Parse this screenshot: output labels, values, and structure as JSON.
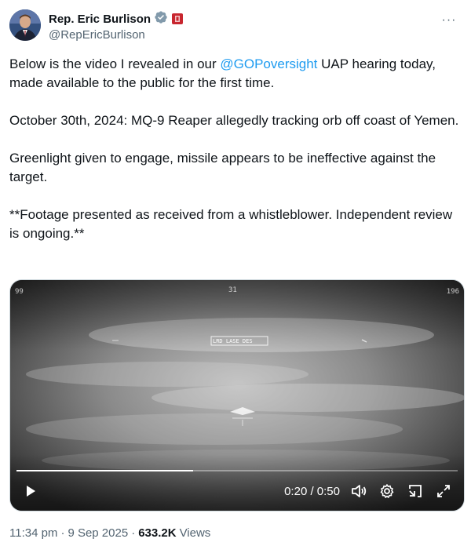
{
  "author": {
    "display_name": "Rep. Eric Burlison",
    "handle": "@RepEricBurlison"
  },
  "more_label": "···",
  "tweet": {
    "p1_before": "Below is the video I revealed in our ",
    "p1_mention": "@GOPoversight",
    "p1_after": " UAP hearing today, made available to the public for the first time.",
    "p2": "October 30th, 2024: MQ-9 Reaper allegedly tracking orb off coast of Yemen.",
    "p3": "Greenlight given to engage, missile appears to be ineffective against the target.",
    "p4": "**Footage presented as received from a whistleblower. Independent review is ongoing.**"
  },
  "video": {
    "overlay_text": "LRD LASE DES",
    "hud_top_left": "99",
    "hud_top_right": "196",
    "hud_top_center": "31",
    "time": "0:20 / 0:50",
    "progress": 0.4
  },
  "footer": {
    "time": "11:34 pm",
    "sep1": "·",
    "date": "9 Sep 2025",
    "sep2": "·",
    "views_num": "633.2K",
    "views_label": "Views"
  }
}
